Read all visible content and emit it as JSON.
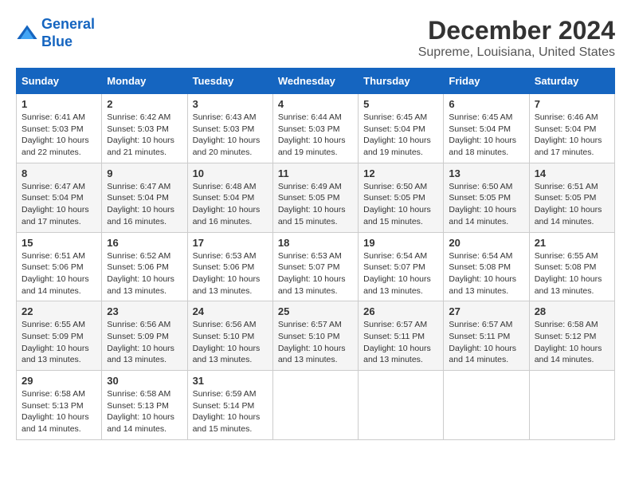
{
  "header": {
    "logo_line1": "General",
    "logo_line2": "Blue",
    "main_title": "December 2024",
    "subtitle": "Supreme, Louisiana, United States"
  },
  "calendar": {
    "days_of_week": [
      "Sunday",
      "Monday",
      "Tuesday",
      "Wednesday",
      "Thursday",
      "Friday",
      "Saturday"
    ],
    "weeks": [
      [
        {
          "day": "",
          "detail": ""
        },
        {
          "day": "2",
          "detail": "Sunrise: 6:42 AM\nSunset: 5:03 PM\nDaylight: 10 hours and 21 minutes."
        },
        {
          "day": "3",
          "detail": "Sunrise: 6:43 AM\nSunset: 5:03 PM\nDaylight: 10 hours and 20 minutes."
        },
        {
          "day": "4",
          "detail": "Sunrise: 6:44 AM\nSunset: 5:03 PM\nDaylight: 10 hours and 19 minutes."
        },
        {
          "day": "5",
          "detail": "Sunrise: 6:45 AM\nSunset: 5:04 PM\nDaylight: 10 hours and 19 minutes."
        },
        {
          "day": "6",
          "detail": "Sunrise: 6:45 AM\nSunset: 5:04 PM\nDaylight: 10 hours and 18 minutes."
        },
        {
          "day": "7",
          "detail": "Sunrise: 6:46 AM\nSunset: 5:04 PM\nDaylight: 10 hours and 17 minutes."
        }
      ],
      [
        {
          "day": "1",
          "detail": "Sunrise: 6:41 AM\nSunset: 5:03 PM\nDaylight: 10 hours and 22 minutes."
        },
        {
          "day": "",
          "detail": ""
        },
        {
          "day": "",
          "detail": ""
        },
        {
          "day": "",
          "detail": ""
        },
        {
          "day": "",
          "detail": ""
        },
        {
          "day": "",
          "detail": ""
        },
        {
          "day": "",
          "detail": ""
        }
      ],
      [
        {
          "day": "8",
          "detail": "Sunrise: 6:47 AM\nSunset: 5:04 PM\nDaylight: 10 hours and 17 minutes."
        },
        {
          "day": "9",
          "detail": "Sunrise: 6:47 AM\nSunset: 5:04 PM\nDaylight: 10 hours and 16 minutes."
        },
        {
          "day": "10",
          "detail": "Sunrise: 6:48 AM\nSunset: 5:04 PM\nDaylight: 10 hours and 16 minutes."
        },
        {
          "day": "11",
          "detail": "Sunrise: 6:49 AM\nSunset: 5:05 PM\nDaylight: 10 hours and 15 minutes."
        },
        {
          "day": "12",
          "detail": "Sunrise: 6:50 AM\nSunset: 5:05 PM\nDaylight: 10 hours and 15 minutes."
        },
        {
          "day": "13",
          "detail": "Sunrise: 6:50 AM\nSunset: 5:05 PM\nDaylight: 10 hours and 14 minutes."
        },
        {
          "day": "14",
          "detail": "Sunrise: 6:51 AM\nSunset: 5:05 PM\nDaylight: 10 hours and 14 minutes."
        }
      ],
      [
        {
          "day": "15",
          "detail": "Sunrise: 6:51 AM\nSunset: 5:06 PM\nDaylight: 10 hours and 14 minutes."
        },
        {
          "day": "16",
          "detail": "Sunrise: 6:52 AM\nSunset: 5:06 PM\nDaylight: 10 hours and 13 minutes."
        },
        {
          "day": "17",
          "detail": "Sunrise: 6:53 AM\nSunset: 5:06 PM\nDaylight: 10 hours and 13 minutes."
        },
        {
          "day": "18",
          "detail": "Sunrise: 6:53 AM\nSunset: 5:07 PM\nDaylight: 10 hours and 13 minutes."
        },
        {
          "day": "19",
          "detail": "Sunrise: 6:54 AM\nSunset: 5:07 PM\nDaylight: 10 hours and 13 minutes."
        },
        {
          "day": "20",
          "detail": "Sunrise: 6:54 AM\nSunset: 5:08 PM\nDaylight: 10 hours and 13 minutes."
        },
        {
          "day": "21",
          "detail": "Sunrise: 6:55 AM\nSunset: 5:08 PM\nDaylight: 10 hours and 13 minutes."
        }
      ],
      [
        {
          "day": "22",
          "detail": "Sunrise: 6:55 AM\nSunset: 5:09 PM\nDaylight: 10 hours and 13 minutes."
        },
        {
          "day": "23",
          "detail": "Sunrise: 6:56 AM\nSunset: 5:09 PM\nDaylight: 10 hours and 13 minutes."
        },
        {
          "day": "24",
          "detail": "Sunrise: 6:56 AM\nSunset: 5:10 PM\nDaylight: 10 hours and 13 minutes."
        },
        {
          "day": "25",
          "detail": "Sunrise: 6:57 AM\nSunset: 5:10 PM\nDaylight: 10 hours and 13 minutes."
        },
        {
          "day": "26",
          "detail": "Sunrise: 6:57 AM\nSunset: 5:11 PM\nDaylight: 10 hours and 13 minutes."
        },
        {
          "day": "27",
          "detail": "Sunrise: 6:57 AM\nSunset: 5:11 PM\nDaylight: 10 hours and 14 minutes."
        },
        {
          "day": "28",
          "detail": "Sunrise: 6:58 AM\nSunset: 5:12 PM\nDaylight: 10 hours and 14 minutes."
        }
      ],
      [
        {
          "day": "29",
          "detail": "Sunrise: 6:58 AM\nSunset: 5:13 PM\nDaylight: 10 hours and 14 minutes."
        },
        {
          "day": "30",
          "detail": "Sunrise: 6:58 AM\nSunset: 5:13 PM\nDaylight: 10 hours and 14 minutes."
        },
        {
          "day": "31",
          "detail": "Sunrise: 6:59 AM\nSunset: 5:14 PM\nDaylight: 10 hours and 15 minutes."
        },
        {
          "day": "",
          "detail": ""
        },
        {
          "day": "",
          "detail": ""
        },
        {
          "day": "",
          "detail": ""
        },
        {
          "day": "",
          "detail": ""
        }
      ]
    ]
  }
}
